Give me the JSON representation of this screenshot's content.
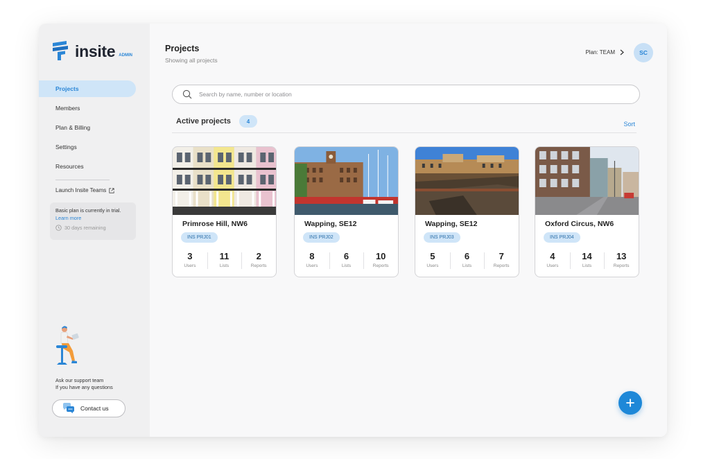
{
  "brand": {
    "name": "insite",
    "tag": "ADMIN"
  },
  "sidebar": {
    "items": [
      {
        "label": "Projects",
        "active": true
      },
      {
        "label": "Members",
        "active": false
      },
      {
        "label": "Plan & Billing",
        "active": false
      },
      {
        "label": "Settings",
        "active": false
      },
      {
        "label": "Resources",
        "active": false
      }
    ],
    "launch_label": "Launch Insite Teams",
    "trial": {
      "text": "Basic plan is currently in trial.",
      "link": "Learn more",
      "days": "30 days remaining"
    },
    "support_line1": "Ask our support team",
    "support_line2": "If you have any questions",
    "contact_label": "Contact us"
  },
  "header": {
    "title": "Projects",
    "subtitle": "Showing all projects",
    "plan_label": "Plan: TEAM",
    "avatar_initials": "SC"
  },
  "search": {
    "placeholder": "Search by name, number or location",
    "value": ""
  },
  "section": {
    "title": "Active projects",
    "count": "4",
    "sort_label": "Sort"
  },
  "stat_labels": {
    "users": "Users",
    "lists": "Lists",
    "reports": "Reports"
  },
  "projects": [
    {
      "name": "Primrose Hill, NW6",
      "code": "INS PRJ01",
      "users": "3",
      "lists": "11",
      "reports": "2",
      "image": "terrace-houses"
    },
    {
      "name": "Wapping, SE12",
      "code": "INS PRJ02",
      "users": "8",
      "lists": "6",
      "reports": "10",
      "image": "dock-warehouse"
    },
    {
      "name": "Wapping, SE12",
      "code": "INS PRJ03",
      "users": "5",
      "lists": "6",
      "reports": "7",
      "image": "rooftop-buildings"
    },
    {
      "name": "Oxford Circus, NW6",
      "code": "INS PRJ04",
      "users": "4",
      "lists": "14",
      "reports": "13",
      "image": "city-street"
    }
  ],
  "colors": {
    "accent": "#2b86d6",
    "accent_light": "#cfe5f8",
    "fab": "#1e88d8"
  },
  "fab_icon": "plus-icon"
}
